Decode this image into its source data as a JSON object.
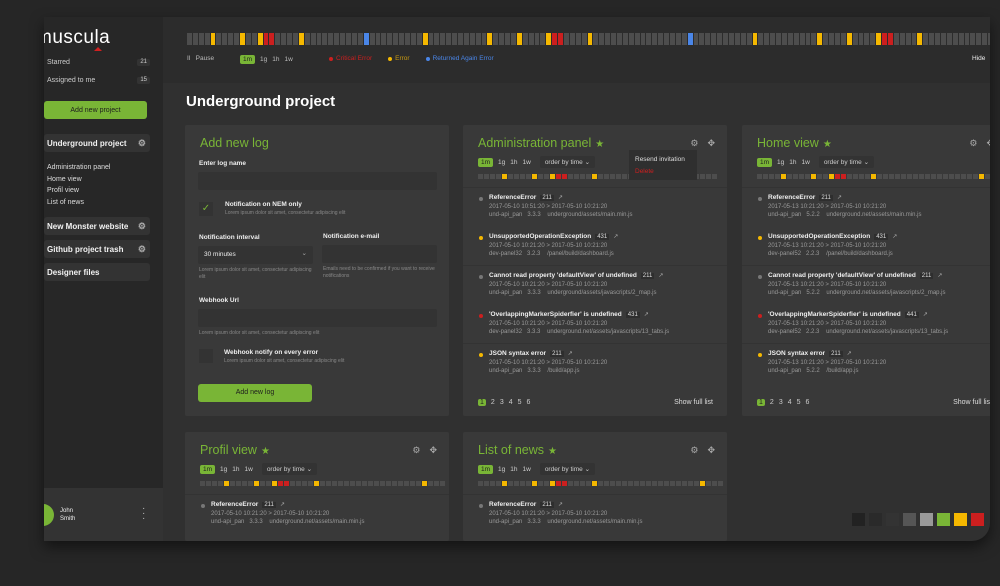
{
  "colors": {
    "accent": "#79b536",
    "error": "#f5b800",
    "critical": "#cc1f1f",
    "returned": "#4a86e8"
  },
  "sidebar": {
    "logo": "muscula",
    "starred_label": "Starred",
    "starred_count": "21",
    "assigned_label": "Assigned to me",
    "assigned_count": "15",
    "add_project": "Add new project",
    "projects": [
      {
        "name": "Underground project",
        "subs": [
          "Administration panel",
          "Home view",
          "Profil view",
          "List of news"
        ]
      },
      {
        "name": "New Monster website"
      },
      {
        "name": "Github project trash"
      },
      {
        "name": "Designer files"
      }
    ],
    "user": {
      "first": "John",
      "last": "Smith"
    }
  },
  "topbar": {
    "pause": "Pause",
    "ranges": [
      "1m",
      "1g",
      "1h",
      "1w"
    ],
    "active_range": "1m",
    "legend": {
      "critical": "Critical Error",
      "error": "Error",
      "returned": "Returned Again Error"
    },
    "hide": "Hide",
    "timeline": "ggggyggggyggyrrggggyggggggggggbgggggggggyggggggggggyggggyggggyrrggggyggggggggggggggggbggggggggggyggggggggggyggggyggggyrrggggyggggggggggggggggbggggggggggygggggggggyggggyrrggy"
  },
  "page_title": "Underground project",
  "form": {
    "title": "Add new log",
    "name_label": "Enter log name",
    "nem_label": "Notification on NEM only",
    "nem_hint": "Lorem ipsum dolor sit amet, consectetur adipiscing elit",
    "nem_checked": true,
    "interval_label": "Notification interval",
    "interval_value": "30 minutes",
    "interval_hint": "Lorem ipsum dolor sit amet, consectetur adipiscing elit",
    "email_label": "Notification e-mail",
    "email_hint": "Emails need to be confirmed if you want to receive notifications",
    "webhook_label": "Webhook Url",
    "webhook_hint": "Lorem ipsum dolor sit amet, consectetur adipiscing elit",
    "every_label": "Webhook notify on every error",
    "every_hint": "Lorem ipsum dolor sit amet, consectetur adipiscing elit",
    "every_checked": false,
    "submit": "Add new log"
  },
  "cards": [
    {
      "title": "Administration panel",
      "order": "order by time",
      "mini": "ggggyggggyggyrrggggygggggggggggggggggggg",
      "menu": [
        "Resend invitation",
        "Delete"
      ],
      "logs": [
        {
          "level": "none",
          "name": "ReferenceError",
          "count": "211",
          "time": "2017-05-10 10:51:20  >  2017-05-10 10:21:20",
          "app": "und-api_pan",
          "ver": "3.3.3",
          "file": "underground/assets/main.min.js"
        },
        {
          "level": "error",
          "name": "UnsupportedOperationException",
          "count": "431",
          "time": "2017-05-10 10:21:20  >  2017-05-10 10:21:20",
          "app": "dev-panel32",
          "ver": "3.2.3",
          "file": "/panel/build/dashboard.js"
        },
        {
          "level": "none",
          "name": "Cannot read property 'defaultView' of undefined",
          "count": "211",
          "time": "2017-05-10 10:21:20  >  2017-05-10 10:21:20",
          "app": "und-api_pan",
          "ver": "3.3.3",
          "file": "underground/assets/javascripts/2_map.js"
        },
        {
          "level": "critical",
          "name": "'OverlappingMarkerSpiderfier' is undefined",
          "count": "431",
          "time": "2017-05-10 10:21:20  >  2017-05-10 10:21:20",
          "app": "dev-panel32",
          "ver": "3.3.3",
          "file": "underground.net/assets/javascripts/13_tabs.js"
        },
        {
          "level": "error",
          "name": "JSON syntax error",
          "count": "211",
          "time": "2017-05-10 10:21:20  >  2017-05-10 10:21:20",
          "app": "und-api_pan",
          "ver": "3.3.3",
          "file": "/build/app.js"
        }
      ],
      "pages": [
        "1",
        "2",
        "3",
        "4",
        "5",
        "6"
      ],
      "show_full": "Show full list"
    },
    {
      "title": "Home view",
      "order": "order by time",
      "mini": "ggggyggggyggyrrggggygggggggggggggggggyggg",
      "logs": [
        {
          "level": "none",
          "name": "ReferenceError",
          "count": "211",
          "time": "2017-05-13 10:21:20  >  2017-05-10 10:21:20",
          "app": "und-api_pan",
          "ver": "5.2.2",
          "file": "underground.net/assets/main.min.js"
        },
        {
          "level": "error",
          "name": "UnsupportedOperationException",
          "count": "431",
          "time": "2017-05-13 10:21:20  >  2017-05-10 10:21:20",
          "app": "dev-panel52",
          "ver": "2.2.3",
          "file": "/panel/build/dashboard.js"
        },
        {
          "level": "none",
          "name": "Cannot read property 'defaultView' of undefined",
          "count": "211",
          "time": "2017-05-13 10:21:20  >  2017-05-10 10:21:20",
          "app": "und-api_pan",
          "ver": "5.2.2",
          "file": "underground.net/assets/javascripts/2_map.js"
        },
        {
          "level": "critical",
          "name": "'OverlappingMarkerSpiderfier' is undefined",
          "count": "441",
          "time": "2017-05-13 10:21:20  >  2017-05-10 10:21:20",
          "app": "dev-panel52",
          "ver": "2.2.3",
          "file": "underground.net/assets/javascripts/13_tabs.js"
        },
        {
          "level": "error",
          "name": "JSON syntax error",
          "count": "211",
          "time": "2017-05-13 10:21:20  >  2017-05-10 10:21:20",
          "app": "und-api_pan",
          "ver": "5.2.2",
          "file": "/build/app.js"
        }
      ],
      "pages": [
        "1",
        "2",
        "3",
        "4",
        "5",
        "6"
      ],
      "show_full": "Show full list"
    },
    {
      "title": "Profil view",
      "order": "order by time",
      "mini": "ggggyggggyggyrrggggygggggggggggggggggyggg",
      "logs": [
        {
          "level": "none",
          "name": "ReferenceError",
          "count": "211",
          "time": "2017-05-10 10:21:20  >  2017-05-10 10:21:20",
          "app": "und-api_pan",
          "ver": "3.3.3",
          "file": "underground.net/assets/main.min.js"
        }
      ]
    },
    {
      "title": "List of news",
      "order": "order by time",
      "mini": "ggggyggggyggyrrggggygggggggggggggggggyggg",
      "logs": [
        {
          "level": "none",
          "name": "ReferenceError",
          "count": "211",
          "time": "2017-05-10 10:21:20  >  2017-05-10 10:21:20",
          "app": "und-api_pan",
          "ver": "3.3.3",
          "file": "underground.net/assets/main.min.js"
        }
      ]
    }
  ],
  "swatches": [
    "#222222",
    "#2a2a2a",
    "#333333",
    "#555555",
    "#999999",
    "#79b536",
    "#f5b800",
    "#cc1f1f"
  ]
}
